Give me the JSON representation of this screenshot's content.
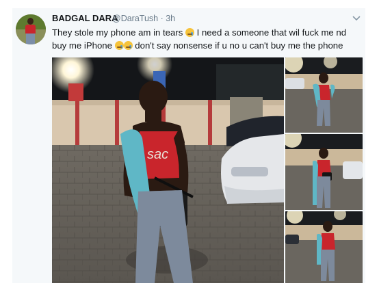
{
  "tweet": {
    "author_name": "BADGAL DARA",
    "handle_time": "@DaraTush · 3h",
    "text_parts": [
      "They stole my phone am in tears ",
      " I need a someone that wil fuck me nd buy me iPhone ",
      " don't say nonsense if u no u can't buy me the phone"
    ],
    "emojis": [
      "loudly-crying-face",
      "crying-face",
      "crying-face"
    ]
  },
  "photo": {
    "shirt_text": "sac"
  },
  "colors": {
    "name_text": "#14171a",
    "meta_text": "#657786",
    "card_bg": "#f5f8fa",
    "shirt_red": "#c9252c",
    "scarf_teal": "#5fb7c6"
  },
  "icons": [
    "chevron-down-icon"
  ]
}
